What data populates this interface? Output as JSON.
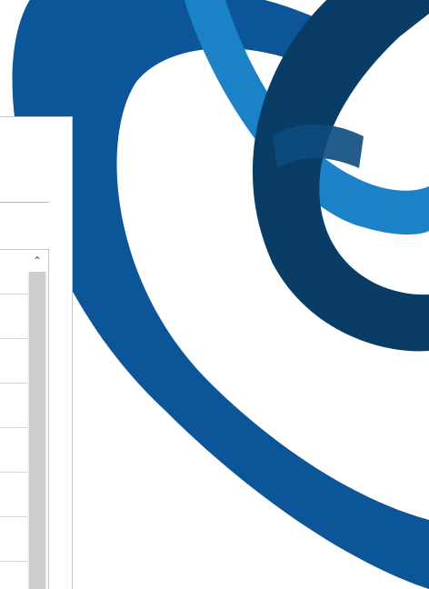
{
  "wallpaper": {
    "name": "abstract-swirl-logo",
    "colors": {
      "dark_navy": "#0a3d66",
      "royal_blue": "#0b5598",
      "sky_blue": "#1b82c8",
      "background": "#ffffff"
    }
  },
  "window": {
    "list": {
      "row_count": 7,
      "scroll_up_icon": "chevron-up-icon"
    }
  }
}
